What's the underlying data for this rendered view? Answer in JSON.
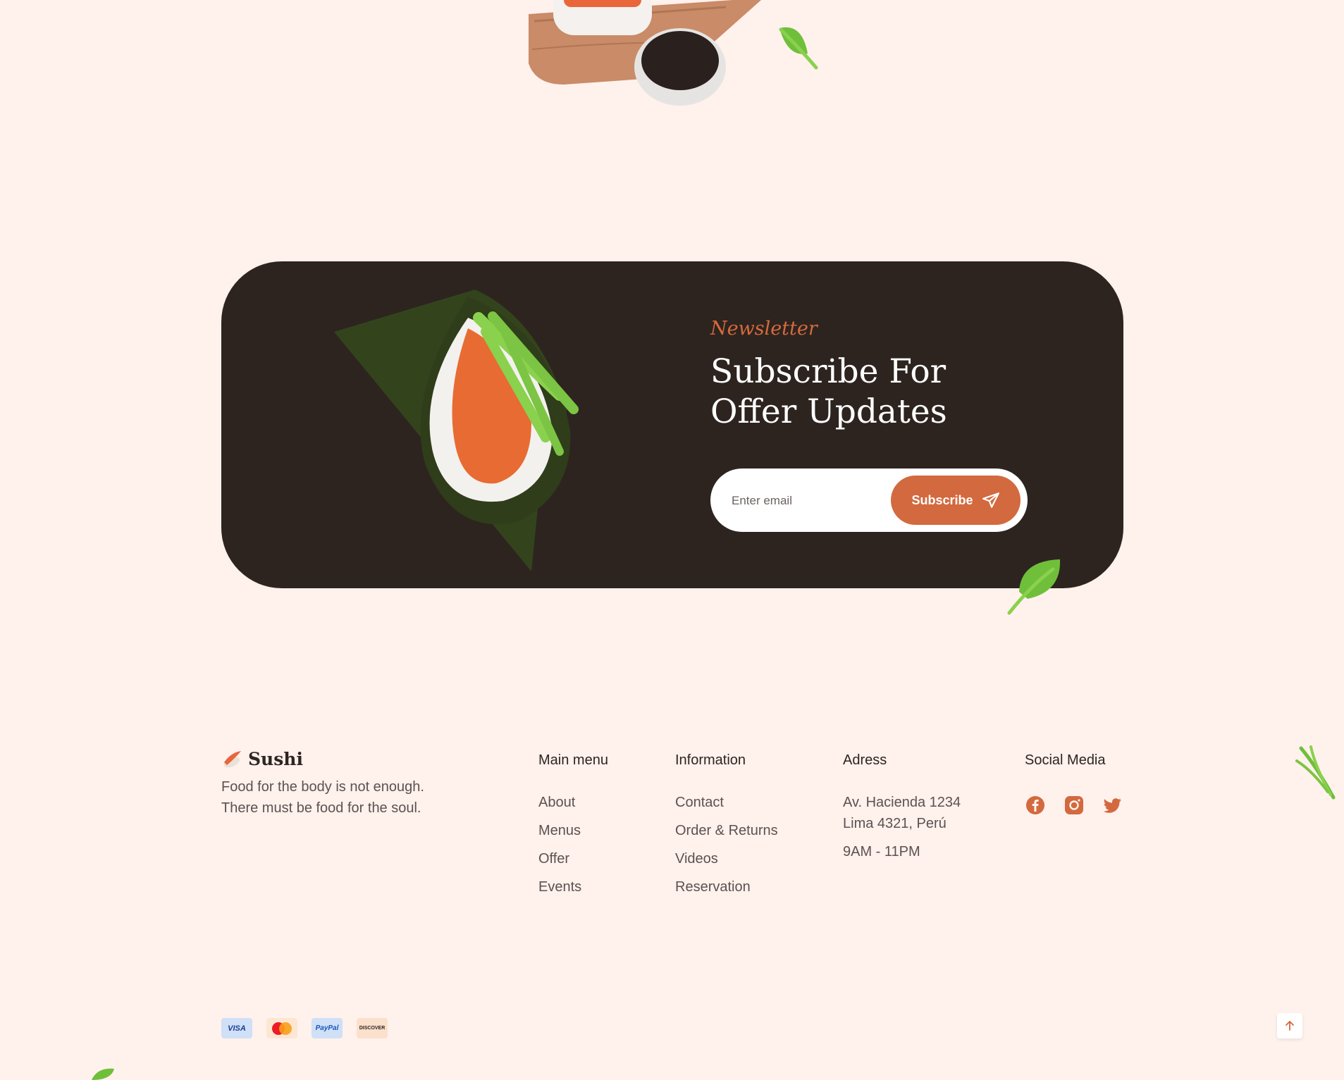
{
  "newsletter": {
    "eyebrow": "Newsletter",
    "title": "Subscribe For Offer Updates",
    "email_placeholder": "Enter email",
    "email_value": "",
    "subscribe_label": "Subscribe"
  },
  "brand": {
    "name": "Sushi",
    "tagline": "Food for the body is not enough. There must be food for the soul."
  },
  "footer": {
    "main_menu": {
      "title": "Main menu",
      "items": [
        "About",
        "Menus",
        "Offer",
        "Events"
      ]
    },
    "information": {
      "title": "Information",
      "items": [
        "Contact",
        "Order & Returns",
        "Videos",
        "Reservation"
      ]
    },
    "address": {
      "title": "Adress",
      "line1": "Av. Hacienda 1234",
      "line2": "Lima 4321, Perú",
      "hours": "9AM - 11PM"
    },
    "social": {
      "title": "Social Media",
      "icons": [
        "facebook-icon",
        "instagram-icon",
        "twitter-icon"
      ]
    },
    "payments": {
      "visa": "VISA",
      "paypal": "PayPal",
      "discover": "DISCOVER"
    }
  },
  "colors": {
    "background": "#fff1ec",
    "card": "#2d2420",
    "accent": "#d3693e",
    "leaf": "#6fbf3a"
  }
}
